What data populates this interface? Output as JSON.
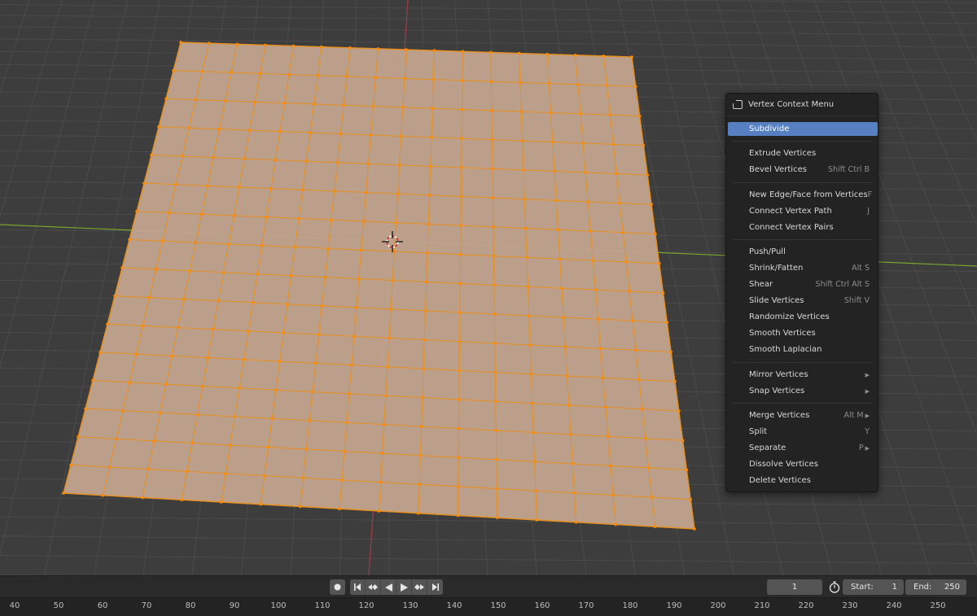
{
  "context_menu": {
    "title": "Vertex Context Menu",
    "items": [
      {
        "label": "Subdivide",
        "shortcut": "",
        "submenu": false,
        "highlighted": true
      },
      {
        "label": "Extrude Vertices",
        "shortcut": "",
        "submenu": false
      },
      {
        "label": "Bevel Vertices",
        "shortcut": "Shift Ctrl B",
        "submenu": false
      },
      {
        "label": "New Edge/Face from Vertices",
        "shortcut": "F",
        "submenu": false
      },
      {
        "label": "Connect Vertex Path",
        "shortcut": "J",
        "submenu": false
      },
      {
        "label": "Connect Vertex Pairs",
        "shortcut": "",
        "submenu": false
      },
      {
        "label": "Push/Pull",
        "shortcut": "",
        "submenu": false
      },
      {
        "label": "Shrink/Fatten",
        "shortcut": "Alt S",
        "submenu": false
      },
      {
        "label": "Shear",
        "shortcut": "Shift Ctrl Alt S",
        "submenu": false
      },
      {
        "label": "Slide Vertices",
        "shortcut": "Shift V",
        "submenu": false
      },
      {
        "label": "Randomize Vertices",
        "shortcut": "",
        "submenu": false
      },
      {
        "label": "Smooth Vertices",
        "shortcut": "",
        "submenu": false
      },
      {
        "label": "Smooth Laplacian",
        "shortcut": "",
        "submenu": false
      },
      {
        "label": "Mirror Vertices",
        "shortcut": "",
        "submenu": true
      },
      {
        "label": "Snap Vertices",
        "shortcut": "",
        "submenu": true
      },
      {
        "label": "Merge Vertices",
        "shortcut": "Alt M",
        "submenu": true
      },
      {
        "label": "Split",
        "shortcut": "Y",
        "submenu": false
      },
      {
        "label": "Separate",
        "shortcut": "P",
        "submenu": true
      },
      {
        "label": "Dissolve Vertices",
        "shortcut": "",
        "submenu": false
      },
      {
        "label": "Delete Vertices",
        "shortcut": "",
        "submenu": false
      }
    ]
  },
  "timeline": {
    "current_frame": "1",
    "start_label": "Start:",
    "start_value": "1",
    "end_label": "End:",
    "end_value": "250",
    "ruler": [
      "40",
      "50",
      "60",
      "70",
      "80",
      "90",
      "100",
      "110",
      "120",
      "130",
      "140",
      "150",
      "160",
      "170",
      "180",
      "190",
      "200",
      "210",
      "220",
      "230",
      "240",
      "250"
    ],
    "controls": [
      "record-icon",
      "jump-start-icon",
      "prev-keyframe-icon",
      "play-reverse-icon",
      "play-icon",
      "next-keyframe-icon",
      "jump-end-icon",
      "stopwatch-icon"
    ]
  },
  "mesh": {
    "grid_divisions": 16,
    "face_color": "#c2a48f",
    "edge_color": "#e8901e",
    "vertex_color": "#ff8a00"
  },
  "colors": {
    "viewport_bg": "#3d3d3d",
    "x_axis": "#9b3f47",
    "y_axis": "#7aa52c",
    "menu_highlight": "#5680c2"
  }
}
